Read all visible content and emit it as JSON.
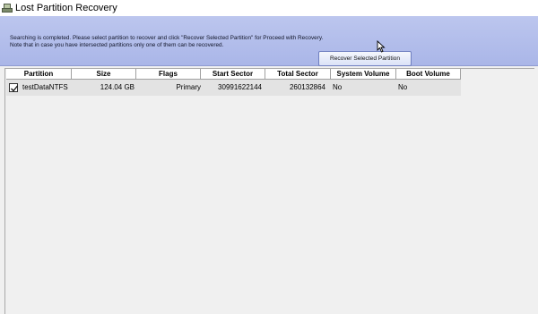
{
  "window": {
    "title": "Lost Partition Recovery",
    "icon": "disk-recovery-icon"
  },
  "header": {
    "message_line1": "Searching is completed. Please select partition to recover and click \"Recover Selected Partition\" for Proceed with Recovery.",
    "message_line2": "Note that in case you have intersected partitions only one of them can be recovered.",
    "recover_button_label": "Recover Selected Partition"
  },
  "table": {
    "columns": [
      "Partition",
      "Size",
      "Flags",
      "Start Sector",
      "Total Sector",
      "System Volume",
      "Boot Volume"
    ],
    "rows": [
      {
        "checked": true,
        "partition": "testDataNTFS",
        "size": "124.04 GB",
        "flags": "Primary",
        "start_sector": "30991622144",
        "total_sector": "260132864",
        "system_volume": "No",
        "boot_volume": "No"
      }
    ]
  },
  "colors": {
    "header_bg": "#aab6e8",
    "content_bg": "#f0f0f0",
    "row_bg": "#e3e3e3"
  }
}
